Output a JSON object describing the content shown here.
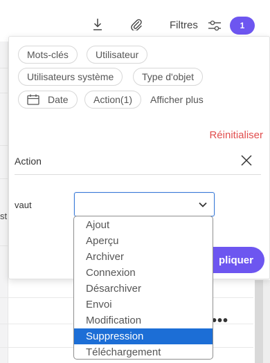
{
  "toolbar": {
    "download_icon": "download-icon",
    "attach_icon": "paperclip-icon",
    "filters_label": "Filtres",
    "filters_icon": "sliders-icon",
    "filters_count": "1"
  },
  "filter_panel": {
    "chips": [
      "Mots-clés",
      "Utilisateur",
      "Utilisateurs système",
      "Type d'objet",
      "Date",
      "Action(1)"
    ],
    "show_more": "Afficher plus",
    "reset": "Réinitialiser",
    "action_label": "Action",
    "operator_label": "vaut",
    "select_value": "",
    "apply_label": "Appliquer",
    "apply_visible": "pliquer"
  },
  "dropdown": {
    "options": [
      "Ajout",
      "Aperçu",
      "Archiver",
      "Connexion",
      "Désarchiver",
      "Envoi",
      "Modification",
      "Suppression",
      "Téléchargement"
    ],
    "highlighted": "Suppression"
  },
  "background": {
    "partial_text": "st",
    "row_menu": "•••"
  },
  "colors": {
    "accent": "#6d56f0",
    "reset": "#e14d4d",
    "selected": "#1c6ed6",
    "focus_border": "#3c7cd8"
  }
}
